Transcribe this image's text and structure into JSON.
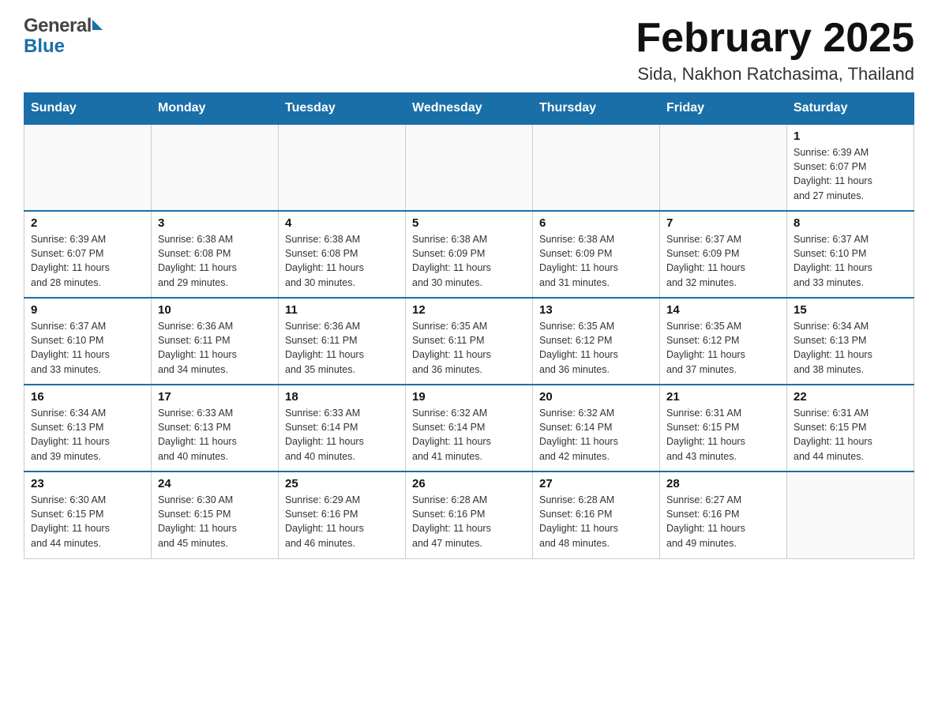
{
  "header": {
    "month_title": "February 2025",
    "location": "Sida, Nakhon Ratchasima, Thailand",
    "logo_general": "General",
    "logo_blue": "Blue"
  },
  "days_of_week": [
    "Sunday",
    "Monday",
    "Tuesday",
    "Wednesday",
    "Thursday",
    "Friday",
    "Saturday"
  ],
  "weeks": [
    [
      {
        "day": "",
        "info": ""
      },
      {
        "day": "",
        "info": ""
      },
      {
        "day": "",
        "info": ""
      },
      {
        "day": "",
        "info": ""
      },
      {
        "day": "",
        "info": ""
      },
      {
        "day": "",
        "info": ""
      },
      {
        "day": "1",
        "info": "Sunrise: 6:39 AM\nSunset: 6:07 PM\nDaylight: 11 hours\nand 27 minutes."
      }
    ],
    [
      {
        "day": "2",
        "info": "Sunrise: 6:39 AM\nSunset: 6:07 PM\nDaylight: 11 hours\nand 28 minutes."
      },
      {
        "day": "3",
        "info": "Sunrise: 6:38 AM\nSunset: 6:08 PM\nDaylight: 11 hours\nand 29 minutes."
      },
      {
        "day": "4",
        "info": "Sunrise: 6:38 AM\nSunset: 6:08 PM\nDaylight: 11 hours\nand 30 minutes."
      },
      {
        "day": "5",
        "info": "Sunrise: 6:38 AM\nSunset: 6:09 PM\nDaylight: 11 hours\nand 30 minutes."
      },
      {
        "day": "6",
        "info": "Sunrise: 6:38 AM\nSunset: 6:09 PM\nDaylight: 11 hours\nand 31 minutes."
      },
      {
        "day": "7",
        "info": "Sunrise: 6:37 AM\nSunset: 6:09 PM\nDaylight: 11 hours\nand 32 minutes."
      },
      {
        "day": "8",
        "info": "Sunrise: 6:37 AM\nSunset: 6:10 PM\nDaylight: 11 hours\nand 33 minutes."
      }
    ],
    [
      {
        "day": "9",
        "info": "Sunrise: 6:37 AM\nSunset: 6:10 PM\nDaylight: 11 hours\nand 33 minutes."
      },
      {
        "day": "10",
        "info": "Sunrise: 6:36 AM\nSunset: 6:11 PM\nDaylight: 11 hours\nand 34 minutes."
      },
      {
        "day": "11",
        "info": "Sunrise: 6:36 AM\nSunset: 6:11 PM\nDaylight: 11 hours\nand 35 minutes."
      },
      {
        "day": "12",
        "info": "Sunrise: 6:35 AM\nSunset: 6:11 PM\nDaylight: 11 hours\nand 36 minutes."
      },
      {
        "day": "13",
        "info": "Sunrise: 6:35 AM\nSunset: 6:12 PM\nDaylight: 11 hours\nand 36 minutes."
      },
      {
        "day": "14",
        "info": "Sunrise: 6:35 AM\nSunset: 6:12 PM\nDaylight: 11 hours\nand 37 minutes."
      },
      {
        "day": "15",
        "info": "Sunrise: 6:34 AM\nSunset: 6:13 PM\nDaylight: 11 hours\nand 38 minutes."
      }
    ],
    [
      {
        "day": "16",
        "info": "Sunrise: 6:34 AM\nSunset: 6:13 PM\nDaylight: 11 hours\nand 39 minutes."
      },
      {
        "day": "17",
        "info": "Sunrise: 6:33 AM\nSunset: 6:13 PM\nDaylight: 11 hours\nand 40 minutes."
      },
      {
        "day": "18",
        "info": "Sunrise: 6:33 AM\nSunset: 6:14 PM\nDaylight: 11 hours\nand 40 minutes."
      },
      {
        "day": "19",
        "info": "Sunrise: 6:32 AM\nSunset: 6:14 PM\nDaylight: 11 hours\nand 41 minutes."
      },
      {
        "day": "20",
        "info": "Sunrise: 6:32 AM\nSunset: 6:14 PM\nDaylight: 11 hours\nand 42 minutes."
      },
      {
        "day": "21",
        "info": "Sunrise: 6:31 AM\nSunset: 6:15 PM\nDaylight: 11 hours\nand 43 minutes."
      },
      {
        "day": "22",
        "info": "Sunrise: 6:31 AM\nSunset: 6:15 PM\nDaylight: 11 hours\nand 44 minutes."
      }
    ],
    [
      {
        "day": "23",
        "info": "Sunrise: 6:30 AM\nSunset: 6:15 PM\nDaylight: 11 hours\nand 44 minutes."
      },
      {
        "day": "24",
        "info": "Sunrise: 6:30 AM\nSunset: 6:15 PM\nDaylight: 11 hours\nand 45 minutes."
      },
      {
        "day": "25",
        "info": "Sunrise: 6:29 AM\nSunset: 6:16 PM\nDaylight: 11 hours\nand 46 minutes."
      },
      {
        "day": "26",
        "info": "Sunrise: 6:28 AM\nSunset: 6:16 PM\nDaylight: 11 hours\nand 47 minutes."
      },
      {
        "day": "27",
        "info": "Sunrise: 6:28 AM\nSunset: 6:16 PM\nDaylight: 11 hours\nand 48 minutes."
      },
      {
        "day": "28",
        "info": "Sunrise: 6:27 AM\nSunset: 6:16 PM\nDaylight: 11 hours\nand 49 minutes."
      },
      {
        "day": "",
        "info": ""
      }
    ]
  ]
}
